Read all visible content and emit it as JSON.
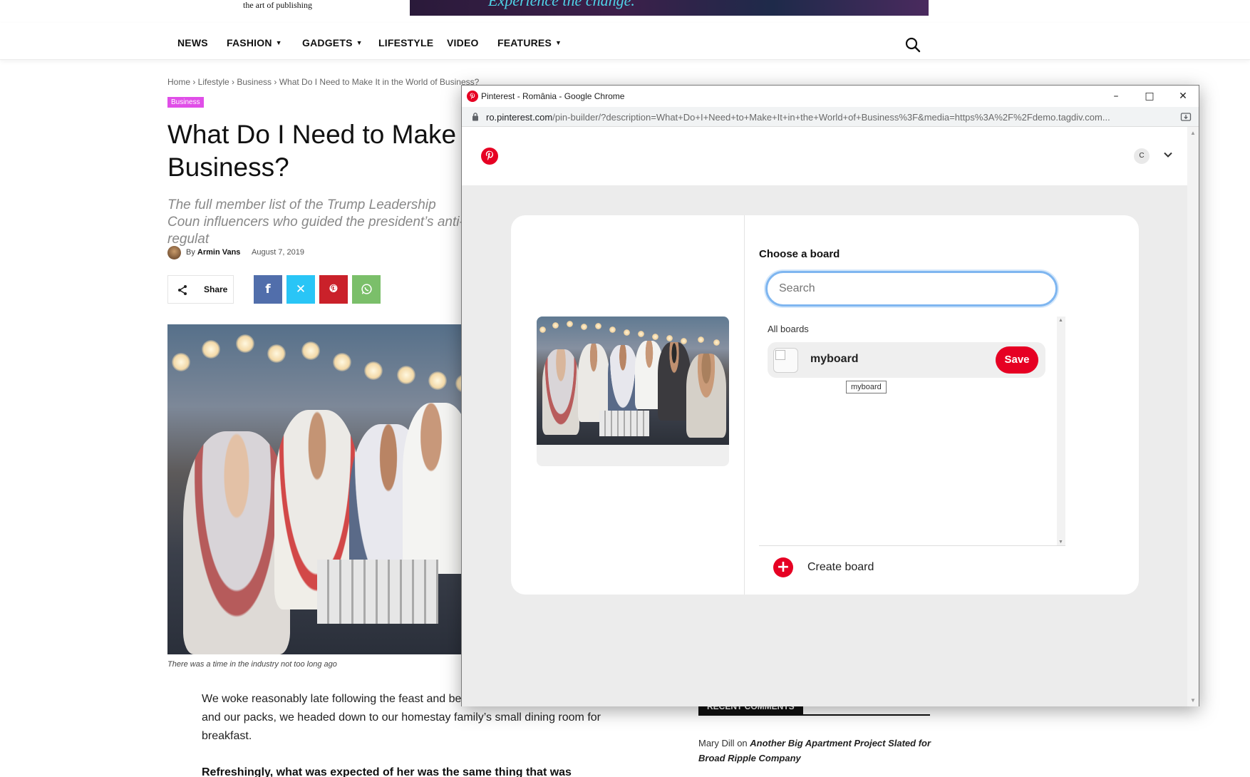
{
  "site": {
    "tagline": "the art of publishing",
    "banner_text": "Experience the change."
  },
  "nav": {
    "items": [
      {
        "label": "NEWS",
        "has_dropdown": false
      },
      {
        "label": "FASHION",
        "has_dropdown": true
      },
      {
        "label": "GADGETS",
        "has_dropdown": true
      },
      {
        "label": "LIFESTYLE",
        "has_dropdown": false
      },
      {
        "label": "VIDEO",
        "has_dropdown": false
      },
      {
        "label": "FEATURES",
        "has_dropdown": true
      }
    ],
    "search_icon": "search-icon",
    "chevron": "⌄"
  },
  "article": {
    "breadcrumb": "Home › Lifestyle › Business › What Do I Need to Make It in the World of Business?",
    "category": "Business",
    "title": "What Do I Need to Make It in the World of Business?",
    "title_visible": "What Do I Need to Make Business?",
    "title_line1": "What Do I Need to Make",
    "title_line2": "Business?",
    "subtitle": "The full member list of the Trump Leadership Coun influencers who guided the president’s anti-regulat",
    "byline_prefix": "By",
    "author": "Armin Vans",
    "date": "August 7, 2019",
    "share_label": "Share",
    "share_buttons": [
      {
        "name": "facebook",
        "glyph": "f",
        "color": "#516eab"
      },
      {
        "name": "twitter-x",
        "glyph": "X",
        "color": "#29c5f6"
      },
      {
        "name": "pinterest",
        "glyph": "P",
        "color": "#ca212a"
      },
      {
        "name": "whatsapp",
        "glyph": "W",
        "color": "#7bbf6a"
      }
    ],
    "caption": "There was a time in the industry not too long ago",
    "paragraph1": "We woke reasonably late following the feast and before. After gathering ourselves and our packs, we headed down to our homestay family’s small dining room for breakfast.",
    "paragraph2": "Refreshingly, what was expected of her was the same thing that was"
  },
  "sidebar": {
    "recent_comments_title": "RECENT COMMENTS",
    "comment_author": "Mary Dill",
    "comment_on": "on",
    "comment_link": "Another Big Apartment Project Slated for Broad Ripple Company"
  },
  "popup": {
    "window_title": "Pinterest - România - Google Chrome",
    "url_host": "ro.pinterest.com",
    "url_path": "/pin-builder/?description=What+Do+I+Need+to+Make+It+in+the+World+of+Business%3F&media=https%3A%2F%2Fdemo.tagdiv.com...",
    "minimize": "–",
    "maximize": "□",
    "close": "✕",
    "avatar_letter": "C",
    "choose_board": "Choose a board",
    "search_placeholder": "Search",
    "search_value": "",
    "all_boards": "All boards",
    "board_name": "myboard",
    "save_label": "Save",
    "tooltip": "myboard",
    "create_board": "Create board",
    "plus": "+"
  },
  "colors": {
    "pinterest_red": "#e60023",
    "category_pink": "#e04ee8",
    "focus_blue": "#7fb6f0"
  }
}
